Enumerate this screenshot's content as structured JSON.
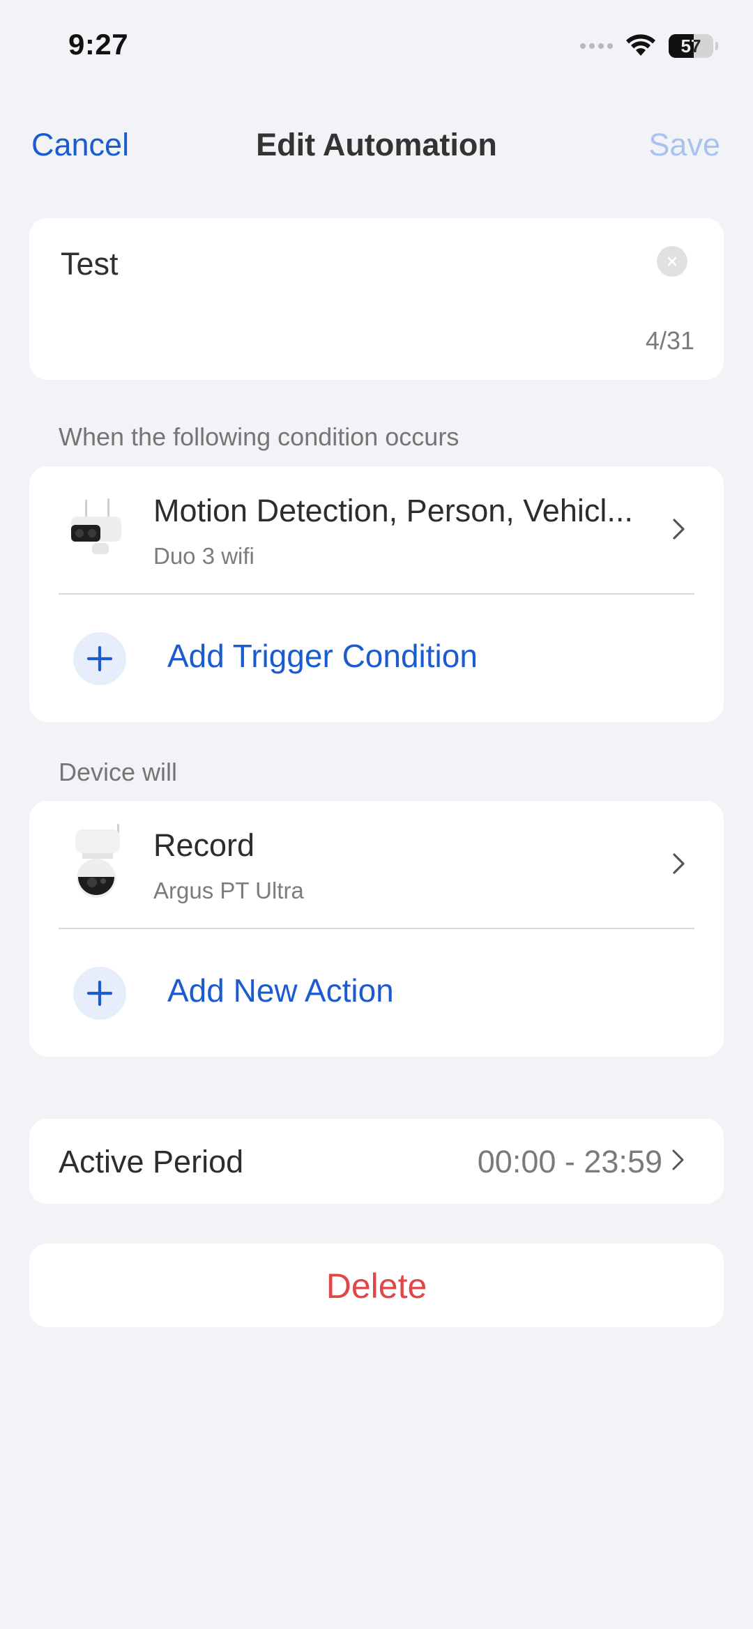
{
  "status_bar": {
    "time": "9:27",
    "battery_level": "57",
    "icons": [
      "cellular-signal-icon",
      "wifi-icon",
      "battery-icon"
    ]
  },
  "nav": {
    "cancel_label": "Cancel",
    "title": "Edit Automation",
    "save_label": "Save"
  },
  "name_field": {
    "value": "Test",
    "char_count": "4/31",
    "clear_icon": "clear-icon"
  },
  "conditions": {
    "section_label": "When the following condition occurs",
    "items": [
      {
        "title": "Motion Detection, Person, Vehicl...",
        "subtitle": "Duo 3 wifi",
        "icon": "camera-thumbnail"
      }
    ],
    "add_label": "Add Trigger Condition"
  },
  "actions": {
    "section_label": "Device will",
    "items": [
      {
        "title": "Record",
        "subtitle": "Argus PT Ultra",
        "icon": "camera-thumbnail"
      }
    ],
    "add_label": "Add New Action"
  },
  "active_period": {
    "label": "Active Period",
    "value": "00:00 - 23:59"
  },
  "delete": {
    "label": "Delete"
  },
  "colors": {
    "background": "#f2f3f6",
    "accent": "#1a5bd0",
    "accent_disabled": "#a9c2ee",
    "destructive": "#e04848",
    "card": "#ffffff"
  }
}
